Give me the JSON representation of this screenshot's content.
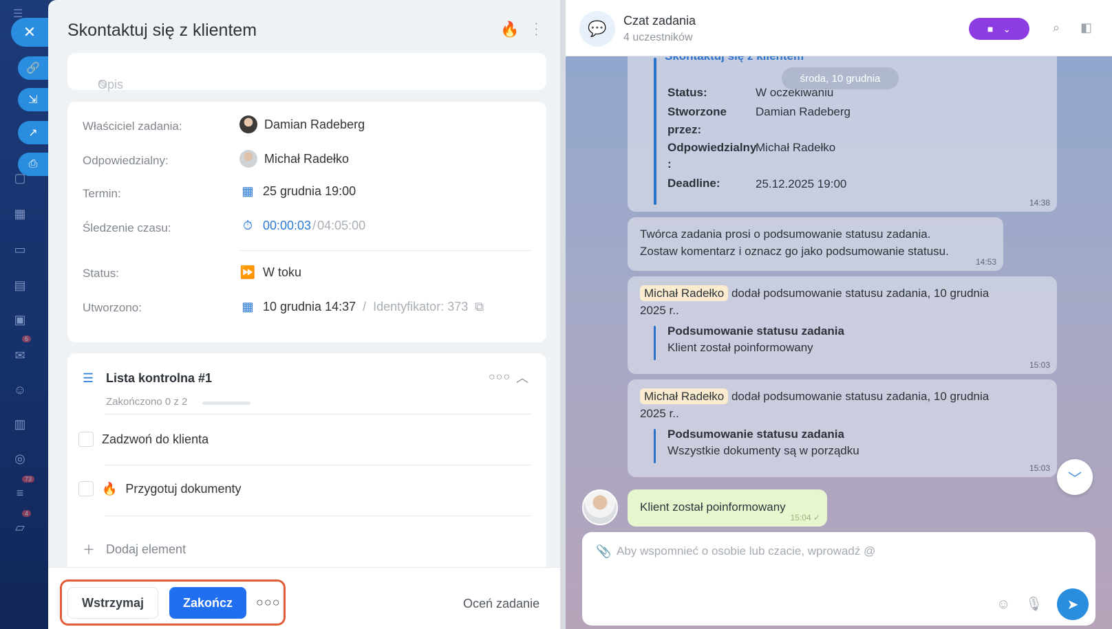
{
  "rail": {
    "badges": [
      "6",
      "73",
      "4"
    ]
  },
  "task": {
    "title": "Skontaktuj się z klientem",
    "description_placeholder": "Opis",
    "fields": {
      "owner_label": "Właściciel zadania:",
      "owner_value": "Damian Radeberg",
      "responsible_label": "Odpowiedzialny:",
      "responsible_value": "Michał Radełko",
      "deadline_label": "Termin:",
      "deadline_value": "25 grudnia 19:00",
      "time_label": "Śledzenie czasu:",
      "time_spent": "00:00:03",
      "time_separator": "/",
      "time_estimate": "04:05:00",
      "status_label": "Status:",
      "status_value": "W toku",
      "created_label": "Utworzono:",
      "created_value": "10 grudnia 14:37",
      "created_separator": "/",
      "id_label": "Identyfikator: 373"
    },
    "checklist": {
      "title": "Lista kontrolna #1",
      "progress_text": "Zakończono 0 z 2",
      "progress_fraction": 0,
      "items": [
        "Zadzwoń do klienta",
        "Przygotuj dokumenty"
      ],
      "add_label": "Dodaj element"
    },
    "footer": {
      "pause_label": "Wstrzymaj",
      "finish_label": "Zakończ",
      "rate_label": "Oceń zadanie"
    }
  },
  "chat": {
    "title": "Czat zadania",
    "subtitle": "4 uczestników",
    "date_separator": "środa, 10 grudnia",
    "card": {
      "header": "Skontaktuj się z klientem",
      "status_key": "Status:",
      "status_value": "W oczekiwaniu",
      "created_key_1": "Stworzone",
      "created_key_2": "przez:",
      "created_value": "Damian Radeberg",
      "responsible_key_1": "Odpowiedzialny",
      "responsible_key_2": ":",
      "responsible_value": "Michał Radełko",
      "deadline_key": "Deadline:",
      "deadline_value": "25.12.2025 19:00",
      "time": "14:38"
    },
    "system_msg": {
      "line1": "Twórca zadania prosi o podsumowanie statusu zadania.",
      "line2": "Zostaw komentarz i oznacz go jako podsumowanie statusu.",
      "time": "14:53"
    },
    "summaries": [
      {
        "mention": "Michał Radełko",
        "text1": "dodał podsumowanie statusu zadania, 10 grudnia",
        "text2": "2025 r..",
        "quote_title": "Podsumowanie statusu zadania",
        "quote_text": "Klient został poinformowany",
        "time": "15:03"
      },
      {
        "mention": "Michał Radełko",
        "text1": "dodał podsumowanie statusu zadania, 10 grudnia",
        "text2": "2025 r..",
        "quote_title": "Podsumowanie statusu zadania",
        "quote_text": "Wszystkie dokumenty są w porządku",
        "time": "15:03"
      }
    ],
    "my_msg": {
      "text": "Klient został poinformowany",
      "time": "15:04"
    },
    "composer_placeholder": "Aby wspomnieć o osobie lub czacie, wprowadź @"
  }
}
